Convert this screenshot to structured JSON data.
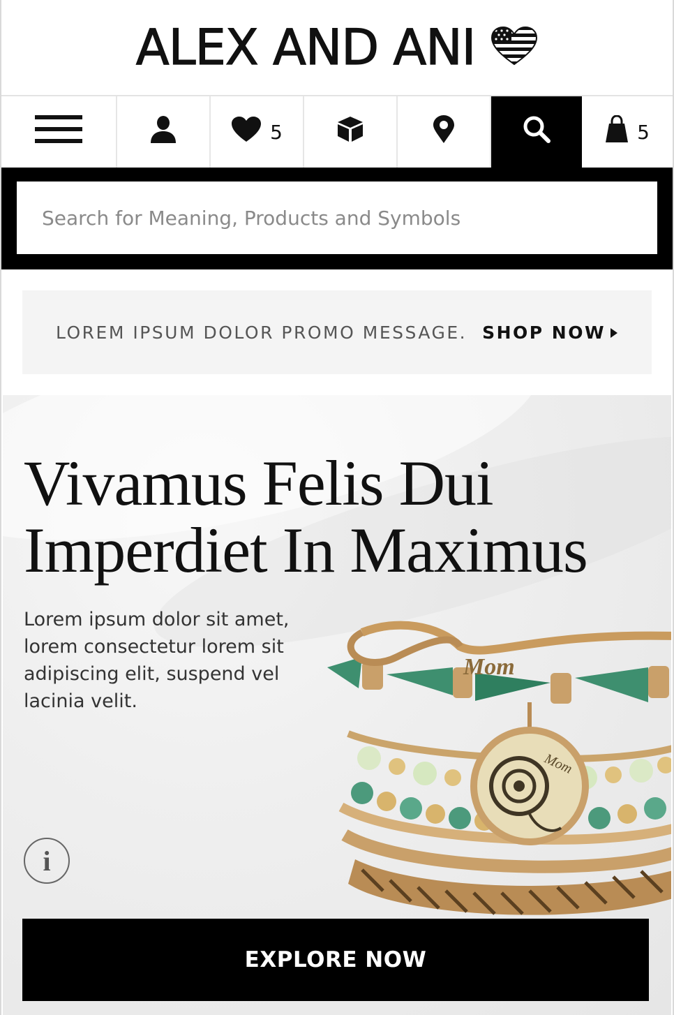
{
  "header": {
    "brand": "ALEX AND ANI",
    "brand_icon": "flag-heart-icon"
  },
  "nav": {
    "menu_icon": "hamburger-menu-icon",
    "account_icon": "user-icon",
    "wishlist_icon": "heart-icon",
    "wishlist_count": "5",
    "orders_icon": "box-icon",
    "stores_icon": "location-pin-icon",
    "search_icon": "search-icon",
    "bag_icon": "shopping-bag-icon",
    "bag_count": "5"
  },
  "search": {
    "placeholder": "Search for Meaning, Products and Symbols",
    "value": ""
  },
  "promo": {
    "message": "LOREM IPSUM DOLOR PROMO MESSAGE.",
    "link_label": "SHOP NOW"
  },
  "hero": {
    "title_line1": "Vivamus Felis Dui",
    "title_line2": "Imperdiet In Maximus",
    "copy_line1": "Lorem ipsum dolor sit amet,",
    "copy_line2": "lorem consectetur lorem sit",
    "copy_line3": "adipiscing elit, suspend vel",
    "copy_line4": "lacinia velit.",
    "info_label": "i",
    "charm_label_1": "Mom",
    "charm_label_2": "Mom",
    "cta_label": "EXPLORE NOW"
  },
  "colors": {
    "black": "#000000",
    "promo_bg": "#f4f4f4",
    "gold": "#c9a06a",
    "jade": "#3e8f6f"
  }
}
